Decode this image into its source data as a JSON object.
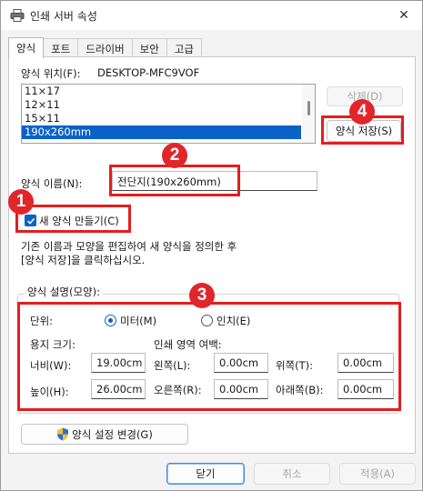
{
  "window": {
    "title": "인쇄 서버 속성",
    "close_symbol": "✕"
  },
  "tabs": [
    {
      "label": "양식",
      "active": true
    },
    {
      "label": "포트"
    },
    {
      "label": "드라이버"
    },
    {
      "label": "보안"
    },
    {
      "label": "고급"
    }
  ],
  "forms_location": {
    "label": "양식 위치(F):",
    "value": "DESKTOP-MFC9VOF"
  },
  "forms_list": {
    "items": [
      "11×17",
      "12×11",
      "15×11",
      "190x260mm"
    ],
    "selected": "190x260mm"
  },
  "buttons": {
    "delete": "삭제(D)",
    "save_form": "양식 저장(S)",
    "change_form_settings": "양식 설정 변경(G)",
    "close": "닫기",
    "cancel": "취소",
    "apply": "적용(A)"
  },
  "form_name": {
    "label": "양식 이름(N):",
    "value": "전단지(190x260mm)"
  },
  "create_new_form": {
    "label": "새 양식 만들기(C)",
    "checked": true
  },
  "description": [
    "기존 이름과 모양을 편집하여 새 양식을 정의한 후",
    "[양식 저장]을 클릭하십시오."
  ],
  "form_description": {
    "title": "양식 설명(모양):",
    "units_label": "단위:",
    "unit_metric": "미터(M)",
    "unit_inch": "인치(E)",
    "selected_unit": "metric",
    "paper_size_label": "용지 크기:",
    "margins_label": "인쇄 영역 여백:",
    "width_label": "너비(W):",
    "width_value": "19.00cm",
    "height_label": "높이(H):",
    "height_value": "26.00cm",
    "left_label": "왼쪽(L):",
    "left_value": "0.00cm",
    "right_label": "오른쪽(R):",
    "right_value": "0.00cm",
    "top_label": "위쪽(T):",
    "top_value": "0.00cm",
    "bottom_label": "아래쪽(B):",
    "bottom_value": "0.00cm"
  },
  "annotations": {
    "badge1": "1",
    "badge2": "2",
    "badge3": "3",
    "badge4": "4",
    "color": "#e41e1e"
  },
  "icons": {
    "title": "printer-icon",
    "shield": "uac-shield-icon"
  }
}
